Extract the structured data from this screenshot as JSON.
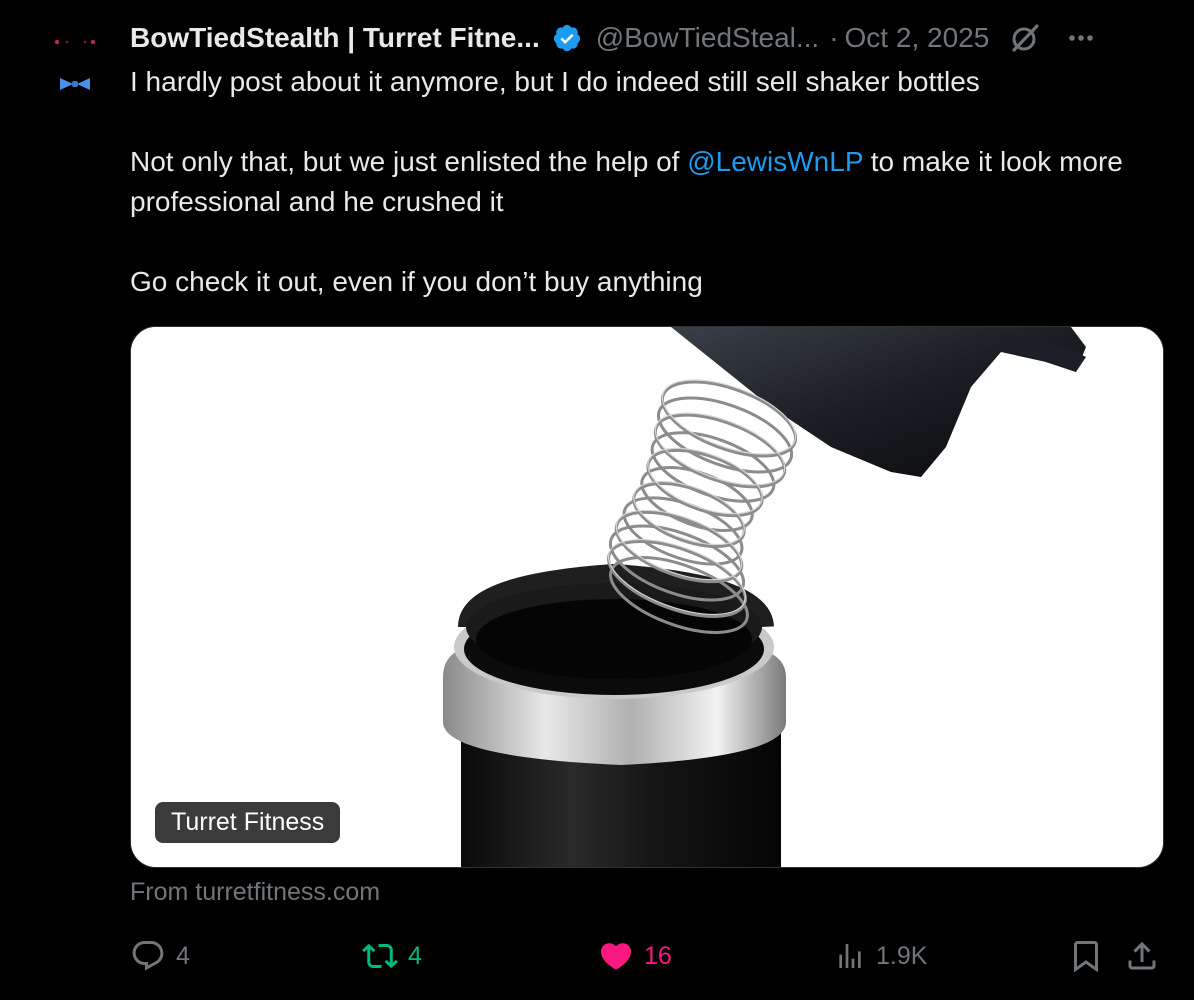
{
  "author": {
    "display_name": "BowTiedStealth | Turret Fitne...",
    "handle": "@BowTiedSteal...",
    "verified_icon": "verified-badge-icon",
    "avatar_icon": "bowtie-avatar"
  },
  "meta": {
    "separator": "·",
    "date": "Oct 2, 2025"
  },
  "body": {
    "line1": "I hardly post about it anymore, but I do indeed still sell shaker bottles",
    "line2_prefix": "Not only that, but we just enlisted the help of ",
    "line2_mention": "@LewisWnLP",
    "line2_suffix": " to make it look more professional and he crushed it",
    "line3": "Go check it out, even if you don’t buy anything"
  },
  "card": {
    "label": "Turret Fitness",
    "source": "From turretfitness.com"
  },
  "actions": {
    "reply_count": "4",
    "retweet_count": "4",
    "like_count": "16",
    "views_count": "1.9K"
  },
  "colors": {
    "background": "#000000",
    "text": "#e7e9ea",
    "muted": "#71767b",
    "link": "#1d9bf0",
    "retweet": "#00ba7c",
    "like": "#f91880"
  }
}
